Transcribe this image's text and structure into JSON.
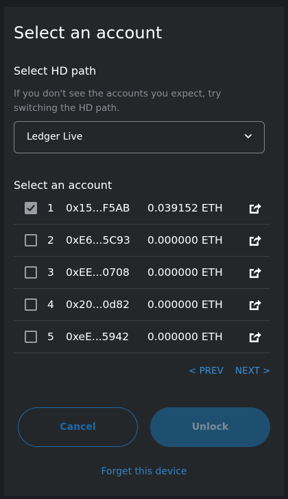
{
  "title": "Select an account",
  "hd_path": {
    "label": "Select HD path",
    "help": "If you don't see the accounts you expect, try switching the HD path.",
    "selected": "Ledger Live",
    "chevron_icon": "chevron-down-icon"
  },
  "accounts_label": "Select an account",
  "accounts": [
    {
      "index": "1",
      "address": "0x15...F5AB",
      "balance": "0.039152 ETH",
      "checked": true
    },
    {
      "index": "2",
      "address": "0xE6...5C93",
      "balance": "0.000000 ETH",
      "checked": false
    },
    {
      "index": "3",
      "address": "0xEE...0708",
      "balance": "0.000000 ETH",
      "checked": false
    },
    {
      "index": "4",
      "address": "0x20...0d82",
      "balance": "0.000000 ETH",
      "checked": false
    },
    {
      "index": "5",
      "address": "0xeE...5942",
      "balance": "0.000000 ETH",
      "checked": false
    }
  ],
  "pagination": {
    "prev": "< PREV",
    "next": "NEXT >"
  },
  "buttons": {
    "cancel": "Cancel",
    "unlock": "Unlock"
  },
  "forget": "Forget this device",
  "colors": {
    "background": "#24272a",
    "accent": "#2e83c9",
    "unlock_bg": "#1f4f70"
  }
}
